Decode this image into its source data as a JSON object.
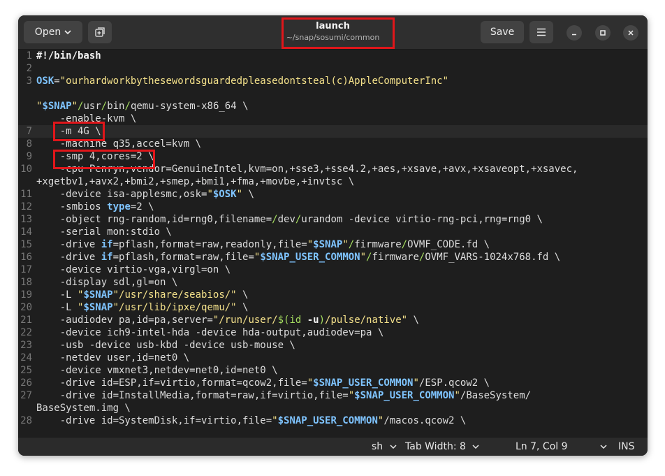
{
  "header": {
    "open_label": "Open",
    "title": "launch",
    "subtitle": "~/snap/sosumi/common",
    "save_label": "Save"
  },
  "status": {
    "language": "sh",
    "tab_width": "Tab Width: 8",
    "position": "Ln 7, Col 9",
    "mode": "INS"
  },
  "lines": [
    {
      "n": "1",
      "segs": [
        {
          "c": "sh",
          "t": "#!/bin/bash"
        }
      ]
    },
    {
      "n": "2",
      "segs": []
    },
    {
      "n": "3",
      "segs": [
        {
          "c": "var",
          "t": "OSK"
        },
        {
          "c": "",
          "t": "="
        },
        {
          "c": "str",
          "t": "\"ourhardworkbythesewordsguardedpleasedontsteal(c)AppleComputerInc\""
        }
      ]
    },
    {
      "n": "",
      "segs": []
    },
    {
      "n": "",
      "segs": [
        {
          "c": "str",
          "t": "\""
        },
        {
          "c": "var",
          "t": "$SNAP"
        },
        {
          "c": "str",
          "t": "\""
        },
        {
          "c": "sl",
          "t": "/"
        },
        {
          "c": "",
          "t": "usr"
        },
        {
          "c": "sl",
          "t": "/"
        },
        {
          "c": "",
          "t": "bin"
        },
        {
          "c": "sl",
          "t": "/"
        },
        {
          "c": "",
          "t": "qemu-system-x86_64 \\"
        }
      ]
    },
    {
      "n": "",
      "segs": [
        {
          "c": "",
          "t": "    -enable-kvm \\"
        }
      ]
    },
    {
      "n": "7",
      "segs": [
        {
          "c": "",
          "t": "    -m 4G \\"
        }
      ]
    },
    {
      "n": "8",
      "segs": [
        {
          "c": "",
          "t": "    -machine q35,accel=kvm \\"
        }
      ]
    },
    {
      "n": "9",
      "segs": [
        {
          "c": "",
          "t": "    -smp 4,cores=2 \\"
        }
      ]
    },
    {
      "n": "10",
      "segs": [
        {
          "c": "",
          "t": "    -cpu Penryn,vendor=GenuineIntel,kvm=on,+sse3,+sse4.2,+aes,+xsave,+avx,+xsaveopt,+xsavec,"
        }
      ]
    },
    {
      "n": "",
      "segs": [
        {
          "c": "",
          "t": "+xgetbv1,+avx2,+bmi2,+smep,+bmi1,+fma,+movbe,+invtsc \\"
        }
      ]
    },
    {
      "n": "11",
      "segs": [
        {
          "c": "",
          "t": "    -device isa-applesmc,osk="
        },
        {
          "c": "str",
          "t": "\""
        },
        {
          "c": "var",
          "t": "$OSK"
        },
        {
          "c": "str",
          "t": "\""
        },
        {
          "c": "",
          "t": " \\"
        }
      ]
    },
    {
      "n": "12",
      "segs": [
        {
          "c": "",
          "t": "    -smbios "
        },
        {
          "c": "kw",
          "t": "type"
        },
        {
          "c": "",
          "t": "=2 \\"
        }
      ]
    },
    {
      "n": "13",
      "segs": [
        {
          "c": "",
          "t": "    -object rng-random,id=rng0,filename="
        },
        {
          "c": "sl",
          "t": "/"
        },
        {
          "c": "",
          "t": "dev"
        },
        {
          "c": "sl",
          "t": "/"
        },
        {
          "c": "",
          "t": "urandom -device virtio-rng-pci,rng=rng0 \\"
        }
      ]
    },
    {
      "n": "14",
      "segs": [
        {
          "c": "",
          "t": "    -serial mon:stdio \\"
        }
      ]
    },
    {
      "n": "15",
      "segs": [
        {
          "c": "",
          "t": "    -drive "
        },
        {
          "c": "kw",
          "t": "if"
        },
        {
          "c": "",
          "t": "=pflash,format=raw,readonly,file="
        },
        {
          "c": "str",
          "t": "\""
        },
        {
          "c": "var",
          "t": "$SNAP"
        },
        {
          "c": "str",
          "t": "\""
        },
        {
          "c": "sl",
          "t": "/"
        },
        {
          "c": "",
          "t": "firmware"
        },
        {
          "c": "sl",
          "t": "/"
        },
        {
          "c": "",
          "t": "OVMF_CODE.fd \\"
        }
      ]
    },
    {
      "n": "16",
      "segs": [
        {
          "c": "",
          "t": "    -drive "
        },
        {
          "c": "kw",
          "t": "if"
        },
        {
          "c": "",
          "t": "=pflash,format=raw,file="
        },
        {
          "c": "str",
          "t": "\""
        },
        {
          "c": "var",
          "t": "$SNAP_USER_COMMON"
        },
        {
          "c": "str",
          "t": "\""
        },
        {
          "c": "sl",
          "t": "/"
        },
        {
          "c": "",
          "t": "firmware"
        },
        {
          "c": "sl",
          "t": "/"
        },
        {
          "c": "",
          "t": "OVMF_VARS-1024x768.fd \\"
        }
      ]
    },
    {
      "n": "17",
      "segs": [
        {
          "c": "",
          "t": "    -device virtio-vga,virgl=on \\"
        }
      ]
    },
    {
      "n": "18",
      "segs": [
        {
          "c": "",
          "t": "    -display sdl,gl=on \\"
        }
      ]
    },
    {
      "n": "19",
      "segs": [
        {
          "c": "",
          "t": "    -L "
        },
        {
          "c": "str",
          "t": "\""
        },
        {
          "c": "var",
          "t": "$SNAP"
        },
        {
          "c": "str",
          "t": "\"/usr/share/seabios/\""
        },
        {
          "c": "",
          "t": " \\"
        }
      ]
    },
    {
      "n": "20",
      "segs": [
        {
          "c": "",
          "t": "    -L "
        },
        {
          "c": "str",
          "t": "\""
        },
        {
          "c": "var",
          "t": "$SNAP"
        },
        {
          "c": "str",
          "t": "\"/usr/lib/ipxe/qemu/\""
        },
        {
          "c": "",
          "t": " \\"
        }
      ]
    },
    {
      "n": "21",
      "segs": [
        {
          "c": "",
          "t": "    -audiodev pa,id=pa,server="
        },
        {
          "c": "str",
          "t": "\"/run/user/"
        },
        {
          "c": "sl",
          "t": "$(id"
        },
        {
          "c": "",
          "t": " "
        },
        {
          "c": "sh",
          "t": "-u"
        },
        {
          "c": "sl",
          "t": ")"
        },
        {
          "c": "str",
          "t": "/pulse/native\""
        },
        {
          "c": "",
          "t": " \\"
        }
      ]
    },
    {
      "n": "22",
      "segs": [
        {
          "c": "",
          "t": "    -device ich9-intel-hda -device hda-output,audiodev=pa \\"
        }
      ]
    },
    {
      "n": "23",
      "segs": [
        {
          "c": "",
          "t": "    -usb -device usb-kbd -device usb-mouse \\"
        }
      ]
    },
    {
      "n": "24",
      "segs": [
        {
          "c": "",
          "t": "    -netdev user,id=net0 \\"
        }
      ]
    },
    {
      "n": "25",
      "segs": [
        {
          "c": "",
          "t": "    -device vmxnet3,netdev=net0,id=net0 \\"
        }
      ]
    },
    {
      "n": "26",
      "segs": [
        {
          "c": "",
          "t": "    -drive id=ESP,if=virtio,format=qcow2,file="
        },
        {
          "c": "str",
          "t": "\""
        },
        {
          "c": "var",
          "t": "$SNAP_USER_COMMON"
        },
        {
          "c": "str",
          "t": "\""
        },
        {
          "c": "",
          "t": "/ESP.qcow2 \\"
        }
      ]
    },
    {
      "n": "27",
      "segs": [
        {
          "c": "",
          "t": "    -drive id=InstallMedia,format=raw,if=virtio,file="
        },
        {
          "c": "str",
          "t": "\""
        },
        {
          "c": "var",
          "t": "$SNAP_USER_COMMON"
        },
        {
          "c": "str",
          "t": "\""
        },
        {
          "c": "",
          "t": "/BaseSystem/"
        }
      ]
    },
    {
      "n": "",
      "segs": [
        {
          "c": "",
          "t": "BaseSystem.img \\"
        }
      ]
    },
    {
      "n": "28",
      "segs": [
        {
          "c": "",
          "t": "    -drive id=SystemDisk,if=virtio,file="
        },
        {
          "c": "str",
          "t": "\""
        },
        {
          "c": "var",
          "t": "$SNAP_USER_COMMON"
        },
        {
          "c": "str",
          "t": "\""
        },
        {
          "c": "",
          "t": "/macos.qcow2 \\"
        }
      ]
    }
  ]
}
